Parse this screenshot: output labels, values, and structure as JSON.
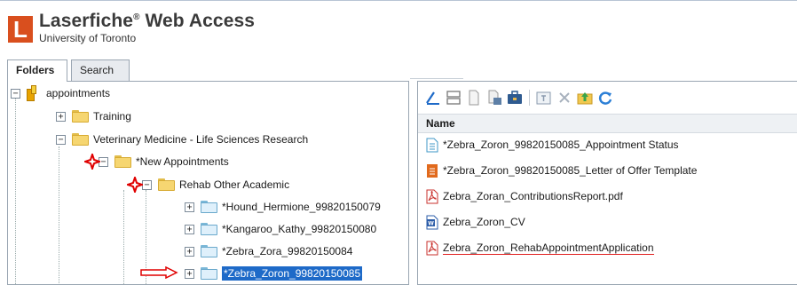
{
  "header": {
    "product_name": "Laserfiche",
    "product_suffix": " Web Access",
    "trademark": "®",
    "organization": "University of Toronto",
    "logo_letter": "L"
  },
  "tabs": [
    {
      "label": "Folders",
      "active": true
    },
    {
      "label": "Search",
      "active": false
    }
  ],
  "tree": {
    "root": "appointments",
    "items": [
      {
        "label": "Training",
        "expander": "+"
      },
      {
        "label": "Veterinary Medicine - Life Sciences Research",
        "expander": "−"
      },
      {
        "label": "*New Appointments",
        "expander": "−"
      },
      {
        "label": "Rehab Other Academic",
        "expander": "−"
      },
      {
        "label": "*Hound_Hermione_99820150079",
        "expander": "+"
      },
      {
        "label": "*Kangaroo_Kathy_99820150080",
        "expander": "+"
      },
      {
        "label": "*Zebra_Zora_99820150084",
        "expander": "+"
      },
      {
        "label": "*Zebra_Zoron_99820150085",
        "expander": "+",
        "selected": true
      }
    ]
  },
  "documents": {
    "column_header": "Name",
    "entries": [
      {
        "name": "*Zebra_Zoron_99820150085_Appointment Status",
        "icon": "form-icon"
      },
      {
        "name": "*Zebra_Zoron_99820150085_Letter of Offer Template",
        "icon": "template-icon"
      },
      {
        "name": "Zebra_Zoran_ContributionsReport.pdf",
        "icon": "pdf-icon"
      },
      {
        "name": "Zebra_Zoron_CV",
        "icon": "word-icon"
      },
      {
        "name": "Zebra_Zoron_RehabAppointmentApplication",
        "icon": "pdf-icon"
      }
    ]
  },
  "colors": {
    "brand": "#d94f1e",
    "selection": "#1e6ac8",
    "annotation": "#e00000"
  }
}
